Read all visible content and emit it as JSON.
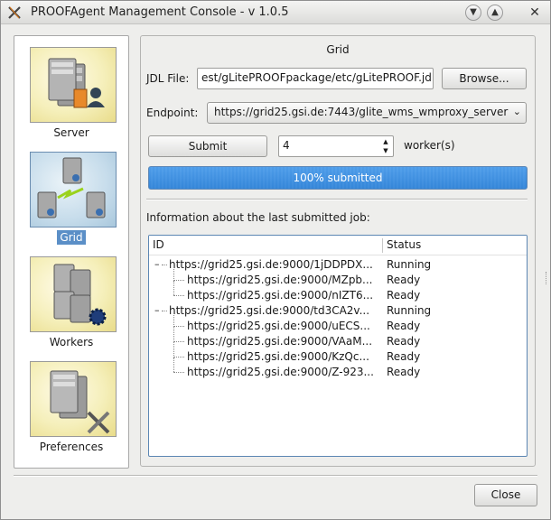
{
  "window": {
    "title": "PROOFAgent Management Console - v 1.0.5"
  },
  "sidebar": {
    "items": [
      {
        "label": "Server",
        "icon": "server-user-icon",
        "active": false
      },
      {
        "label": "Grid",
        "icon": "grid-servers-icon",
        "active": true
      },
      {
        "label": "Workers",
        "icon": "workers-gear-icon",
        "active": false
      },
      {
        "label": "Preferences",
        "icon": "server-tools-icon",
        "active": false
      }
    ]
  },
  "grid": {
    "group_title": "Grid",
    "jdl_label": "JDL File:",
    "jdl_value": "est/gLitePROOFpackage/etc/gLitePROOF.jdl",
    "browse_label": "Browse...",
    "endpoint_label": "Endpoint:",
    "endpoint_value": "https://grid25.gsi.de:7443/glite_wms_wmproxy_server",
    "submit_label": "Submit",
    "workers_value": "4",
    "workers_label": "worker(s)",
    "progress_percent": 100,
    "progress_text": "100% submitted",
    "info_label": "Information about the last submitted job:"
  },
  "jobs_tree": {
    "columns": [
      "ID",
      "Status"
    ],
    "rows": [
      {
        "id": "https://grid25.gsi.de:9000/1jDDPDX...",
        "status": "Running",
        "level": 0
      },
      {
        "id": "https://grid25.gsi.de:9000/MZpb...",
        "status": "Ready",
        "level": 1
      },
      {
        "id": "https://grid25.gsi.de:9000/nIZT6...",
        "status": "Ready",
        "level": 1
      },
      {
        "id": "https://grid25.gsi.de:9000/td3CA2v...",
        "status": "Running",
        "level": 0
      },
      {
        "id": "https://grid25.gsi.de:9000/uECS...",
        "status": "Ready",
        "level": 1
      },
      {
        "id": "https://grid25.gsi.de:9000/VAaM...",
        "status": "Ready",
        "level": 1
      },
      {
        "id": "https://grid25.gsi.de:9000/KzQc...",
        "status": "Ready",
        "level": 1
      },
      {
        "id": "https://grid25.gsi.de:9000/Z-923...",
        "status": "Ready",
        "level": 1
      }
    ]
  },
  "footer": {
    "close_label": "Close"
  }
}
